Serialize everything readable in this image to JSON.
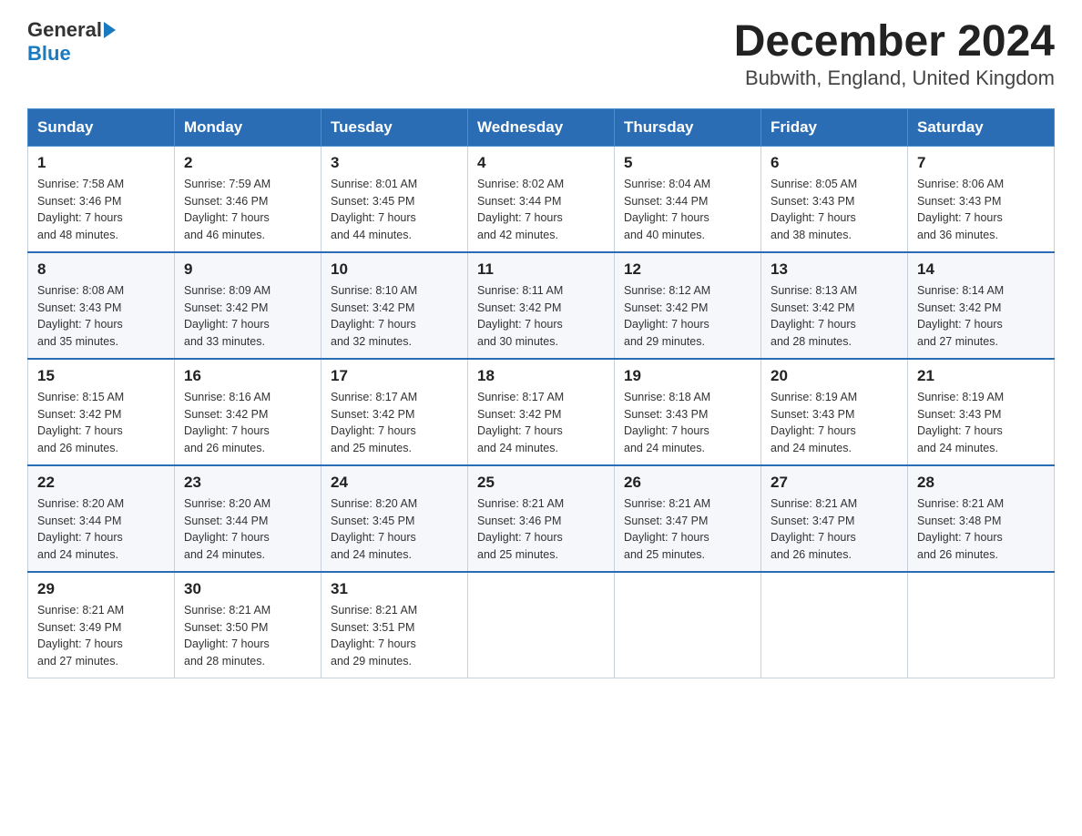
{
  "header": {
    "logo_general": "General",
    "logo_blue": "Blue",
    "title": "December 2024",
    "subtitle": "Bubwith, England, United Kingdom"
  },
  "days_of_week": [
    "Sunday",
    "Monday",
    "Tuesday",
    "Wednesday",
    "Thursday",
    "Friday",
    "Saturday"
  ],
  "weeks": [
    [
      {
        "day": "1",
        "sunrise": "7:58 AM",
        "sunset": "3:46 PM",
        "daylight": "7 hours and 48 minutes."
      },
      {
        "day": "2",
        "sunrise": "7:59 AM",
        "sunset": "3:46 PM",
        "daylight": "7 hours and 46 minutes."
      },
      {
        "day": "3",
        "sunrise": "8:01 AM",
        "sunset": "3:45 PM",
        "daylight": "7 hours and 44 minutes."
      },
      {
        "day": "4",
        "sunrise": "8:02 AM",
        "sunset": "3:44 PM",
        "daylight": "7 hours and 42 minutes."
      },
      {
        "day": "5",
        "sunrise": "8:04 AM",
        "sunset": "3:44 PM",
        "daylight": "7 hours and 40 minutes."
      },
      {
        "day": "6",
        "sunrise": "8:05 AM",
        "sunset": "3:43 PM",
        "daylight": "7 hours and 38 minutes."
      },
      {
        "day": "7",
        "sunrise": "8:06 AM",
        "sunset": "3:43 PM",
        "daylight": "7 hours and 36 minutes."
      }
    ],
    [
      {
        "day": "8",
        "sunrise": "8:08 AM",
        "sunset": "3:43 PM",
        "daylight": "7 hours and 35 minutes."
      },
      {
        "day": "9",
        "sunrise": "8:09 AM",
        "sunset": "3:42 PM",
        "daylight": "7 hours and 33 minutes."
      },
      {
        "day": "10",
        "sunrise": "8:10 AM",
        "sunset": "3:42 PM",
        "daylight": "7 hours and 32 minutes."
      },
      {
        "day": "11",
        "sunrise": "8:11 AM",
        "sunset": "3:42 PM",
        "daylight": "7 hours and 30 minutes."
      },
      {
        "day": "12",
        "sunrise": "8:12 AM",
        "sunset": "3:42 PM",
        "daylight": "7 hours and 29 minutes."
      },
      {
        "day": "13",
        "sunrise": "8:13 AM",
        "sunset": "3:42 PM",
        "daylight": "7 hours and 28 minutes."
      },
      {
        "day": "14",
        "sunrise": "8:14 AM",
        "sunset": "3:42 PM",
        "daylight": "7 hours and 27 minutes."
      }
    ],
    [
      {
        "day": "15",
        "sunrise": "8:15 AM",
        "sunset": "3:42 PM",
        "daylight": "7 hours and 26 minutes."
      },
      {
        "day": "16",
        "sunrise": "8:16 AM",
        "sunset": "3:42 PM",
        "daylight": "7 hours and 26 minutes."
      },
      {
        "day": "17",
        "sunrise": "8:17 AM",
        "sunset": "3:42 PM",
        "daylight": "7 hours and 25 minutes."
      },
      {
        "day": "18",
        "sunrise": "8:17 AM",
        "sunset": "3:42 PM",
        "daylight": "7 hours and 24 minutes."
      },
      {
        "day": "19",
        "sunrise": "8:18 AM",
        "sunset": "3:43 PM",
        "daylight": "7 hours and 24 minutes."
      },
      {
        "day": "20",
        "sunrise": "8:19 AM",
        "sunset": "3:43 PM",
        "daylight": "7 hours and 24 minutes."
      },
      {
        "day": "21",
        "sunrise": "8:19 AM",
        "sunset": "3:43 PM",
        "daylight": "7 hours and 24 minutes."
      }
    ],
    [
      {
        "day": "22",
        "sunrise": "8:20 AM",
        "sunset": "3:44 PM",
        "daylight": "7 hours and 24 minutes."
      },
      {
        "day": "23",
        "sunrise": "8:20 AM",
        "sunset": "3:44 PM",
        "daylight": "7 hours and 24 minutes."
      },
      {
        "day": "24",
        "sunrise": "8:20 AM",
        "sunset": "3:45 PM",
        "daylight": "7 hours and 24 minutes."
      },
      {
        "day": "25",
        "sunrise": "8:21 AM",
        "sunset": "3:46 PM",
        "daylight": "7 hours and 25 minutes."
      },
      {
        "day": "26",
        "sunrise": "8:21 AM",
        "sunset": "3:47 PM",
        "daylight": "7 hours and 25 minutes."
      },
      {
        "day": "27",
        "sunrise": "8:21 AM",
        "sunset": "3:47 PM",
        "daylight": "7 hours and 26 minutes."
      },
      {
        "day": "28",
        "sunrise": "8:21 AM",
        "sunset": "3:48 PM",
        "daylight": "7 hours and 26 minutes."
      }
    ],
    [
      {
        "day": "29",
        "sunrise": "8:21 AM",
        "sunset": "3:49 PM",
        "daylight": "7 hours and 27 minutes."
      },
      {
        "day": "30",
        "sunrise": "8:21 AM",
        "sunset": "3:50 PM",
        "daylight": "7 hours and 28 minutes."
      },
      {
        "day": "31",
        "sunrise": "8:21 AM",
        "sunset": "3:51 PM",
        "daylight": "7 hours and 29 minutes."
      },
      null,
      null,
      null,
      null
    ]
  ],
  "labels": {
    "sunrise": "Sunrise:",
    "sunset": "Sunset:",
    "daylight": "Daylight:"
  }
}
